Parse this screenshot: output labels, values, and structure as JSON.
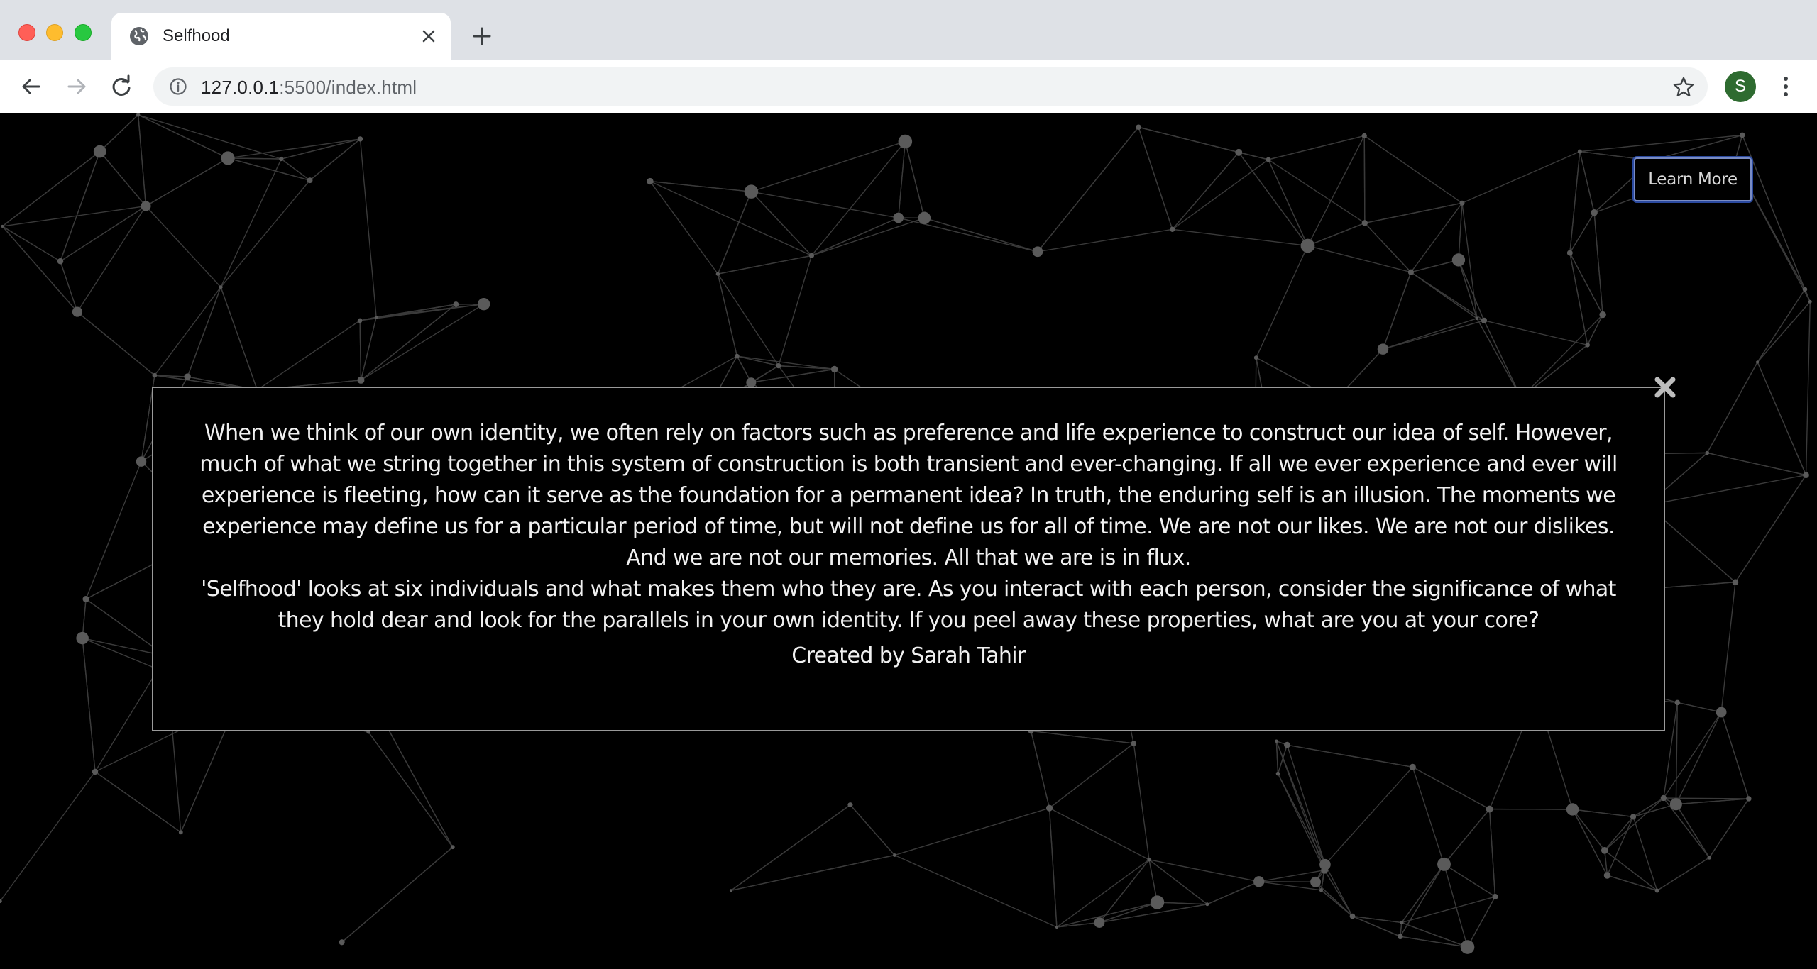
{
  "browser": {
    "tab_title": "Selfhood",
    "url_host": "127.0.0.1",
    "url_path": ":5500/index.html",
    "profile_initial": "S"
  },
  "page": {
    "learn_more_label": "Learn More",
    "modal": {
      "paragraph1": "When we think of our own identity, we often rely on factors such as preference and life experience to construct our idea of self. However, much of what we string together in this system of construction is both transient and ever-changing. If all we ever experience and ever will experience is fleeting, how can it serve as the foundation for a permanent idea? In truth, the enduring self is an illusion. The moments we experience may define us for a particular period of time, but will not define us for all of time. We are not our likes. We are not our dislikes. And we are not our memories. All that we are is in flux.",
      "paragraph2": "'Selfhood' looks at six individuals and what makes them who they are. As you interact with each person, consider the significance of what they hold dear and look for the parallels in your own identity. If you peel away these properties, what are you at your core?",
      "credit": "Created by Sarah Tahir"
    }
  },
  "colors": {
    "background": "#000000",
    "network_line": "#3a3a3a",
    "network_node": "#5a5a5a",
    "button_outline": "#2b4aa0",
    "modal_border": "#9a9a9a"
  }
}
